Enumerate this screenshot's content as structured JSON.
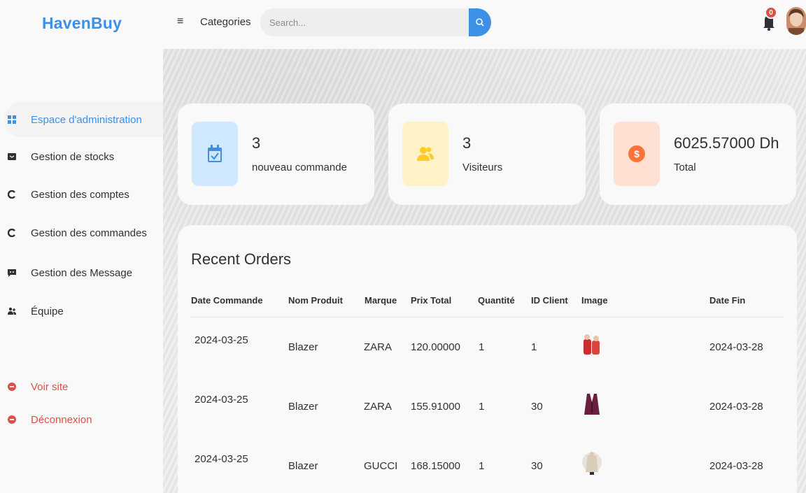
{
  "brand": "HavenBuy",
  "topbar": {
    "menu_icon": "menu-icon",
    "categories_label": "Categories",
    "search_placeholder": "Search...",
    "notification_count": "0"
  },
  "sidebar": {
    "items": [
      {
        "label": "Espace d'administration",
        "icon": "grid-icon"
      },
      {
        "label": "Gestion de stocks",
        "icon": "box-icon"
      },
      {
        "label": "Gestion des comptes",
        "icon": "circle-icon"
      },
      {
        "label": "Gestion des commandes",
        "icon": "circle-icon"
      },
      {
        "label": "Gestion des Message",
        "icon": "message-icon"
      },
      {
        "label": "Équipe",
        "icon": "team-icon"
      }
    ],
    "bottom": [
      {
        "label": "Voir site",
        "icon": "minus-circle-icon"
      },
      {
        "label": "Déconnexion",
        "icon": "minus-circle-icon"
      }
    ]
  },
  "stats": [
    {
      "value": "3",
      "label": "nouveau commande",
      "icon": "calendar-check-icon",
      "color": "#cfe8ff"
    },
    {
      "value": "3",
      "label": "Visiteurs",
      "icon": "people-icon",
      "color": "#fff2c6"
    },
    {
      "value": "6025.57000 Dh",
      "label": "Total",
      "icon": "dollar-circle-icon",
      "color": "#ffe0d3"
    }
  ],
  "orders": {
    "title": "Recent Orders",
    "columns": [
      "Date Commande",
      "Nom Produit",
      "Marque",
      "Prix Total",
      "Quantité",
      "ID Client",
      "Image",
      "Date Fin"
    ],
    "rows": [
      {
        "date": "2024-03-25",
        "product": "Blazer",
        "brand": "ZARA",
        "price": "120.00000",
        "qty": "1",
        "client": "1",
        "image": "product-thumbnail",
        "end": "2024-03-28"
      },
      {
        "date": "2024-03-25",
        "product": "Blazer",
        "brand": "ZARA",
        "price": "155.91000",
        "qty": "1",
        "client": "30",
        "image": "product-thumbnail",
        "end": "2024-03-28"
      },
      {
        "date": "2024-03-25",
        "product": "Blazer",
        "brand": "GUCCI",
        "price": "168.15000",
        "qty": "1",
        "client": "30",
        "image": "product-thumbnail",
        "end": "2024-03-28"
      }
    ]
  },
  "colors": {
    "accent": "#3c91e6",
    "danger": "#db504a",
    "text": "#342e37"
  }
}
